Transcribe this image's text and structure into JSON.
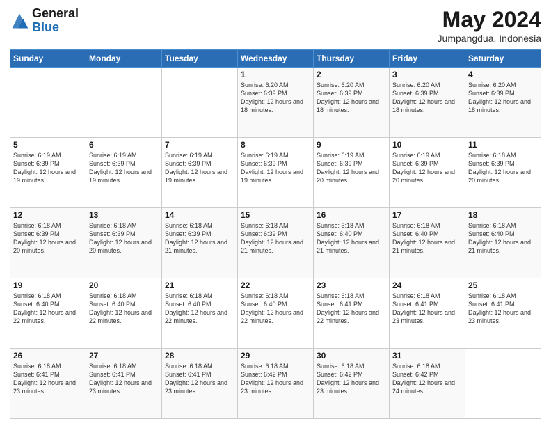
{
  "header": {
    "logo_general": "General",
    "logo_blue": "Blue",
    "title": "May 2024",
    "subtitle": "Jumpangdua, Indonesia"
  },
  "weekdays": [
    "Sunday",
    "Monday",
    "Tuesday",
    "Wednesday",
    "Thursday",
    "Friday",
    "Saturday"
  ],
  "weeks": [
    [
      {
        "day": "",
        "info": ""
      },
      {
        "day": "",
        "info": ""
      },
      {
        "day": "",
        "info": ""
      },
      {
        "day": "1",
        "info": "Sunrise: 6:20 AM\nSunset: 6:39 PM\nDaylight: 12 hours and 18 minutes."
      },
      {
        "day": "2",
        "info": "Sunrise: 6:20 AM\nSunset: 6:39 PM\nDaylight: 12 hours and 18 minutes."
      },
      {
        "day": "3",
        "info": "Sunrise: 6:20 AM\nSunset: 6:39 PM\nDaylight: 12 hours and 18 minutes."
      },
      {
        "day": "4",
        "info": "Sunrise: 6:20 AM\nSunset: 6:39 PM\nDaylight: 12 hours and 18 minutes."
      }
    ],
    [
      {
        "day": "5",
        "info": "Sunrise: 6:19 AM\nSunset: 6:39 PM\nDaylight: 12 hours and 19 minutes."
      },
      {
        "day": "6",
        "info": "Sunrise: 6:19 AM\nSunset: 6:39 PM\nDaylight: 12 hours and 19 minutes."
      },
      {
        "day": "7",
        "info": "Sunrise: 6:19 AM\nSunset: 6:39 PM\nDaylight: 12 hours and 19 minutes."
      },
      {
        "day": "8",
        "info": "Sunrise: 6:19 AM\nSunset: 6:39 PM\nDaylight: 12 hours and 19 minutes."
      },
      {
        "day": "9",
        "info": "Sunrise: 6:19 AM\nSunset: 6:39 PM\nDaylight: 12 hours and 20 minutes."
      },
      {
        "day": "10",
        "info": "Sunrise: 6:19 AM\nSunset: 6:39 PM\nDaylight: 12 hours and 20 minutes."
      },
      {
        "day": "11",
        "info": "Sunrise: 6:18 AM\nSunset: 6:39 PM\nDaylight: 12 hours and 20 minutes."
      }
    ],
    [
      {
        "day": "12",
        "info": "Sunrise: 6:18 AM\nSunset: 6:39 PM\nDaylight: 12 hours and 20 minutes."
      },
      {
        "day": "13",
        "info": "Sunrise: 6:18 AM\nSunset: 6:39 PM\nDaylight: 12 hours and 20 minutes."
      },
      {
        "day": "14",
        "info": "Sunrise: 6:18 AM\nSunset: 6:39 PM\nDaylight: 12 hours and 21 minutes."
      },
      {
        "day": "15",
        "info": "Sunrise: 6:18 AM\nSunset: 6:39 PM\nDaylight: 12 hours and 21 minutes."
      },
      {
        "day": "16",
        "info": "Sunrise: 6:18 AM\nSunset: 6:40 PM\nDaylight: 12 hours and 21 minutes."
      },
      {
        "day": "17",
        "info": "Sunrise: 6:18 AM\nSunset: 6:40 PM\nDaylight: 12 hours and 21 minutes."
      },
      {
        "day": "18",
        "info": "Sunrise: 6:18 AM\nSunset: 6:40 PM\nDaylight: 12 hours and 21 minutes."
      }
    ],
    [
      {
        "day": "19",
        "info": "Sunrise: 6:18 AM\nSunset: 6:40 PM\nDaylight: 12 hours and 22 minutes."
      },
      {
        "day": "20",
        "info": "Sunrise: 6:18 AM\nSunset: 6:40 PM\nDaylight: 12 hours and 22 minutes."
      },
      {
        "day": "21",
        "info": "Sunrise: 6:18 AM\nSunset: 6:40 PM\nDaylight: 12 hours and 22 minutes."
      },
      {
        "day": "22",
        "info": "Sunrise: 6:18 AM\nSunset: 6:40 PM\nDaylight: 12 hours and 22 minutes."
      },
      {
        "day": "23",
        "info": "Sunrise: 6:18 AM\nSunset: 6:41 PM\nDaylight: 12 hours and 22 minutes."
      },
      {
        "day": "24",
        "info": "Sunrise: 6:18 AM\nSunset: 6:41 PM\nDaylight: 12 hours and 23 minutes."
      },
      {
        "day": "25",
        "info": "Sunrise: 6:18 AM\nSunset: 6:41 PM\nDaylight: 12 hours and 23 minutes."
      }
    ],
    [
      {
        "day": "26",
        "info": "Sunrise: 6:18 AM\nSunset: 6:41 PM\nDaylight: 12 hours and 23 minutes."
      },
      {
        "day": "27",
        "info": "Sunrise: 6:18 AM\nSunset: 6:41 PM\nDaylight: 12 hours and 23 minutes."
      },
      {
        "day": "28",
        "info": "Sunrise: 6:18 AM\nSunset: 6:41 PM\nDaylight: 12 hours and 23 minutes."
      },
      {
        "day": "29",
        "info": "Sunrise: 6:18 AM\nSunset: 6:42 PM\nDaylight: 12 hours and 23 minutes."
      },
      {
        "day": "30",
        "info": "Sunrise: 6:18 AM\nSunset: 6:42 PM\nDaylight: 12 hours and 23 minutes."
      },
      {
        "day": "31",
        "info": "Sunrise: 6:18 AM\nSunset: 6:42 PM\nDaylight: 12 hours and 24 minutes."
      },
      {
        "day": "",
        "info": ""
      }
    ]
  ]
}
